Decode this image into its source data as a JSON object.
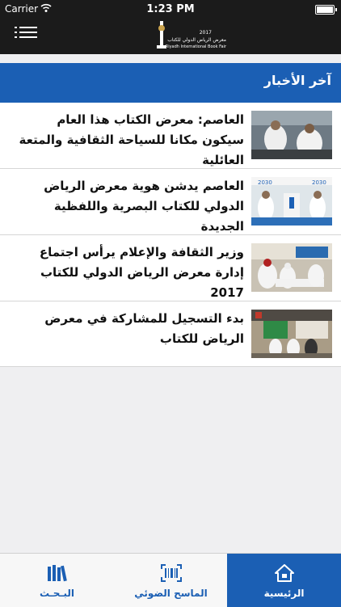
{
  "status_bar": {
    "carrier": "Carrier",
    "time": "1:23 PM"
  },
  "header": {
    "logo_year": "2017",
    "logo_ar": "معرض الرياض الدولي للكتاب",
    "logo_en": "Riyadh International Book Fair"
  },
  "section": {
    "title": "آخر الأخبار"
  },
  "news": [
    {
      "headline": "العاصم: معرض الكتاب هذا العام سيكون مكانا للسياحة الثقافية والمتعة العائلية"
    },
    {
      "headline": "العاصم يدشن هوية معرض الرياض الدولي للكتاب البصرية واللفظية الجديدة"
    },
    {
      "headline": "وزير الثقافة والإعلام يرأس اجتماع إدارة معرض الرياض الدولي للكتاب 2017"
    },
    {
      "headline": "بدء التسجيل للمشاركة في معرض الرياض للكتاب"
    }
  ],
  "tabs": {
    "home": "الرئيسية",
    "scanner": "الماسح الضوئي",
    "search": "البـحـث"
  },
  "colors": {
    "accent": "#1b5fb4",
    "header_bg": "#1b1b1b"
  }
}
